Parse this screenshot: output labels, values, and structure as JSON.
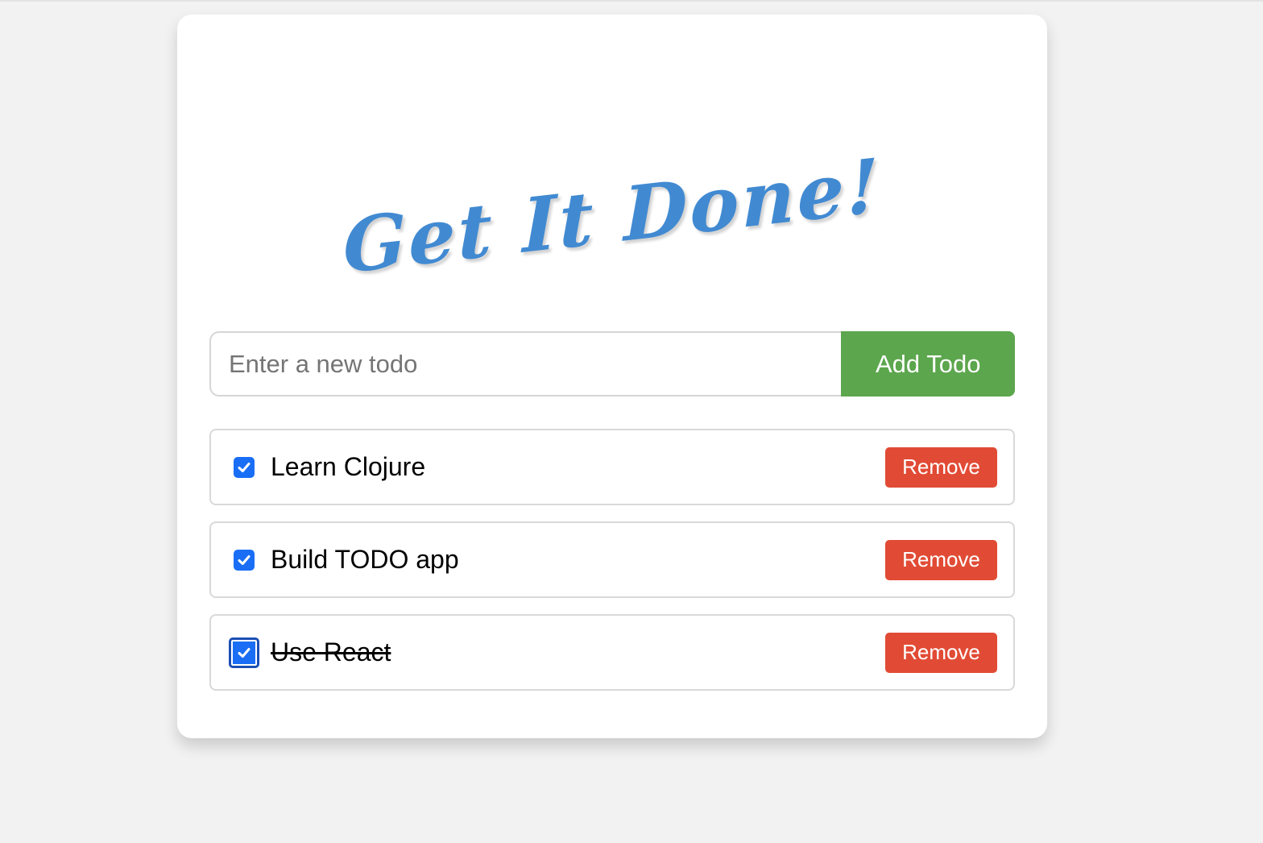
{
  "app": {
    "title": "Get It Done!"
  },
  "add_form": {
    "input_placeholder": "Enter a new todo",
    "input_value": "",
    "add_button_label": "Add Todo"
  },
  "todos": [
    {
      "label": "Learn Clojure",
      "checked": true,
      "completed_style": false,
      "remove_label": "Remove"
    },
    {
      "label": "Build TODO app",
      "checked": true,
      "completed_style": false,
      "remove_label": "Remove"
    },
    {
      "label": "Use React",
      "checked": true,
      "completed_style": true,
      "remove_label": "Remove"
    }
  ],
  "colors": {
    "title": "#418ad2",
    "add_button": "#5ca64d",
    "remove_button": "#e14b35",
    "checkbox": "#1a6ef5",
    "background": "#f2f2f2"
  },
  "icons": {
    "checkbox": "checkmark-icon"
  }
}
